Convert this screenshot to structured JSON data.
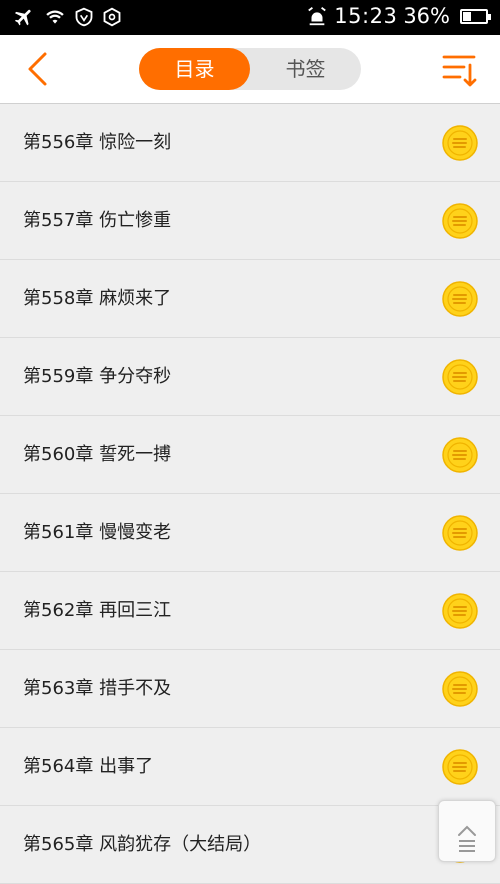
{
  "status_bar": {
    "time": "15:23",
    "battery_percent": "36%",
    "battery_level": 0.36
  },
  "header": {
    "tabs": [
      {
        "label": "目录",
        "active": true
      },
      {
        "label": "书签",
        "active": false
      }
    ]
  },
  "chapters": [
    {
      "title": "第556章 惊险一刻"
    },
    {
      "title": "第557章 伤亡惨重"
    },
    {
      "title": "第558章 麻烦来了"
    },
    {
      "title": "第559章 争分夺秒"
    },
    {
      "title": "第560章 誓死一搏"
    },
    {
      "title": "第561章 慢慢变老"
    },
    {
      "title": "第562章 再回三江"
    },
    {
      "title": "第563章 措手不及"
    },
    {
      "title": "第564章 出事了"
    },
    {
      "title": "第565章 风韵犹存（大结局）"
    }
  ],
  "colors": {
    "accent": "#ff6e00",
    "coin": "#ffd21a"
  },
  "icons": [
    "airplane-icon",
    "wifi-icon",
    "shield-icon",
    "alarm-icon",
    "battery-icon",
    "back-icon",
    "sort-icon",
    "coin-icon",
    "scroll-icon"
  ]
}
